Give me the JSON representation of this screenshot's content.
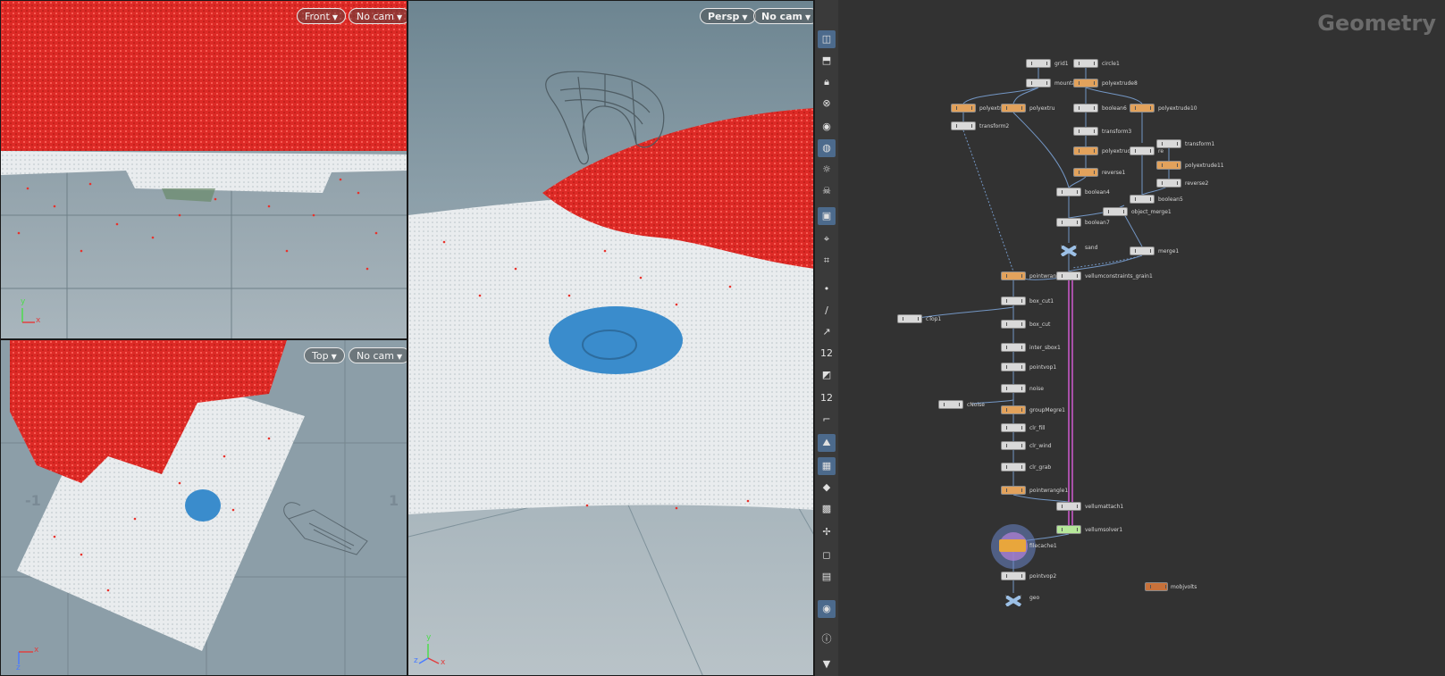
{
  "viewports": {
    "front": {
      "view_label": "Front",
      "cam_label": "No cam"
    },
    "top": {
      "view_label": "Top",
      "cam_label": "No cam",
      "tick_left": "-1",
      "tick_right": "1"
    },
    "persp": {
      "view_label": "Persp",
      "cam_label": "No cam"
    }
  },
  "axes": {
    "x": "x",
    "y": "y",
    "z": "z"
  },
  "network": {
    "title": "Geometry",
    "nodes": [
      {
        "id": "grid1",
        "label": "grid1"
      },
      {
        "id": "circle1",
        "label": "circle1"
      },
      {
        "id": "mountain",
        "label": "mountain"
      },
      {
        "id": "polyextrude8",
        "label": "polyextrude8"
      },
      {
        "id": "polyextrudeA",
        "label": "polyextr"
      },
      {
        "id": "polyextrudeB",
        "label": "polyextru"
      },
      {
        "id": "boolean6",
        "label": "boolean6"
      },
      {
        "id": "polyextrude10",
        "label": "polyextrude10"
      },
      {
        "id": "transform2",
        "label": "transform2"
      },
      {
        "id": "transform3",
        "label": "transform3"
      },
      {
        "id": "transform1",
        "label": "transform1"
      },
      {
        "id": "polyextrude9",
        "label": "polyextrude9"
      },
      {
        "id": "reverseA",
        "label": "re"
      },
      {
        "id": "polyextrude11",
        "label": "polyextrude11"
      },
      {
        "id": "reverse1",
        "label": "reverse1"
      },
      {
        "id": "reverse2",
        "label": "reverse2"
      },
      {
        "id": "boolean4",
        "label": "boolean4"
      },
      {
        "id": "boolean5",
        "label": "boolean5"
      },
      {
        "id": "object_merge1",
        "label": "object_merge1"
      },
      {
        "id": "boolean7",
        "label": "boolean7"
      },
      {
        "id": "sand",
        "label": "sand"
      },
      {
        "id": "merge1",
        "label": "merge1"
      },
      {
        "id": "pointrangle2",
        "label": "pointwrangle2"
      },
      {
        "id": "vellumconstraints_grain1",
        "label": "vellumconstraints_grain1"
      },
      {
        "id": "box_cut1",
        "label": "box_cut1"
      },
      {
        "id": "cTop1",
        "label": "cTop1"
      },
      {
        "id": "box_cut",
        "label": "box_cut"
      },
      {
        "id": "inter_sbox1",
        "label": "inter_sbox1"
      },
      {
        "id": "pointvop1",
        "label": "pointvop1"
      },
      {
        "id": "noise",
        "label": "noise"
      },
      {
        "id": "cNoise",
        "label": "cNoise"
      },
      {
        "id": "groupMegre1",
        "label": "groupMegre1"
      },
      {
        "id": "clr_fill",
        "label": "clr_fill"
      },
      {
        "id": "clr_wind",
        "label": "clr_wind"
      },
      {
        "id": "clr_grab",
        "label": "clr_grab"
      },
      {
        "id": "pointwrangle1",
        "label": "pointwrangle1"
      },
      {
        "id": "vellumattach1",
        "label": "vellumattach1"
      },
      {
        "id": "vellumsolver1",
        "label": "vellumsolver1"
      },
      {
        "id": "filecache1",
        "label": "filecache1"
      },
      {
        "id": "pointvop2",
        "label": "pointvop2"
      },
      {
        "id": "geo",
        "label": "geo"
      },
      {
        "id": "mobjvolts",
        "label": "mobjvolts"
      }
    ]
  },
  "toolbar_numbers": {
    "a": "12",
    "b": "12"
  },
  "colors": {
    "particles_red": "#e8322c",
    "particles_white": "#eef1f3",
    "volume_blue": "#3a8ccc",
    "viewport_bg": "#8da0aa",
    "node_default": "#d9d9d9"
  }
}
